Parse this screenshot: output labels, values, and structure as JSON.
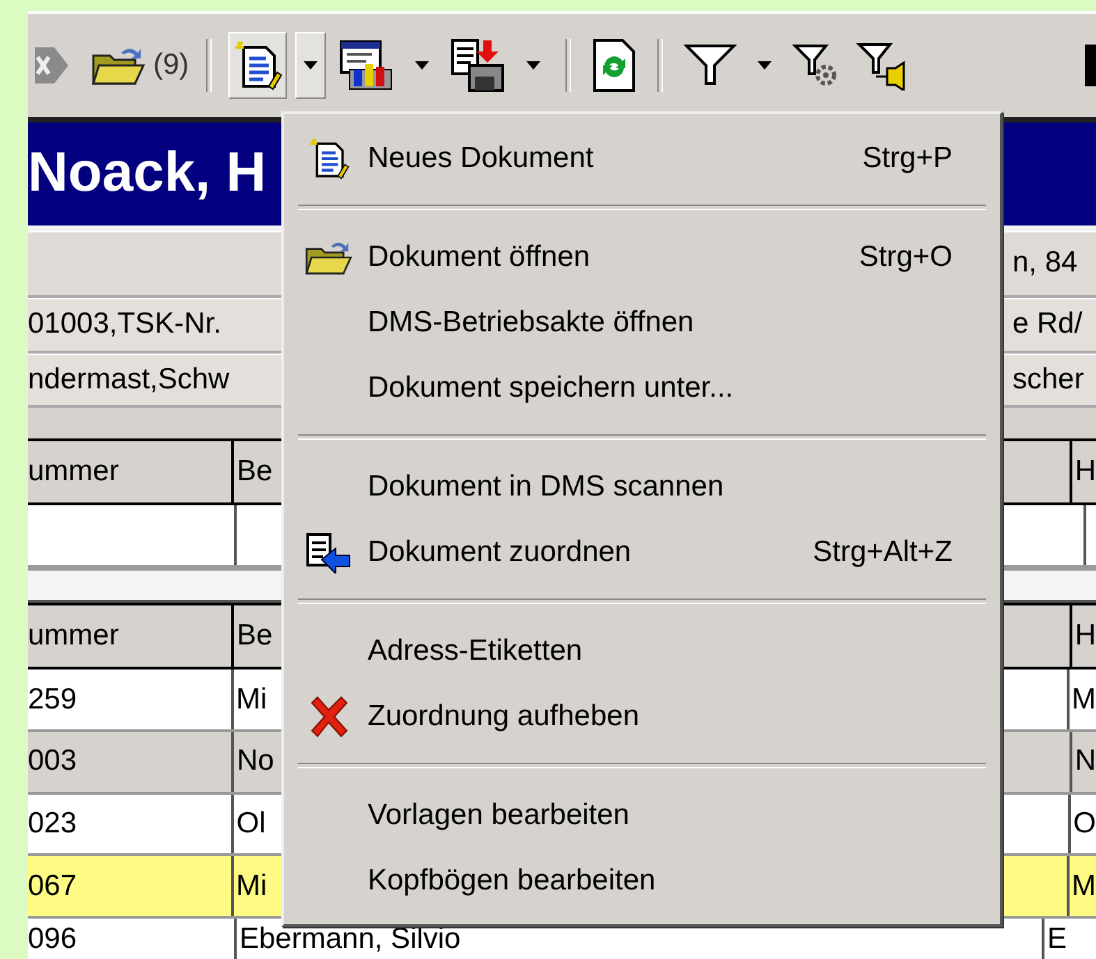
{
  "toolbar": {
    "items": [
      {
        "kind": "icon",
        "pressed": false
      },
      {
        "kind": "icon",
        "pressed": false
      },
      {
        "kind": "text",
        "label": "(9)"
      },
      {
        "kind": "separator"
      },
      {
        "kind": "icon",
        "pressed": true
      },
      {
        "kind": "dropdown",
        "pressed": true
      },
      {
        "kind": "icon",
        "pressed": false
      },
      {
        "kind": "dropdown",
        "pressed": false
      },
      {
        "kind": "icon",
        "pressed": false
      },
      {
        "kind": "dropdown",
        "pressed": false
      },
      {
        "kind": "separator"
      },
      {
        "kind": "icon",
        "pressed": false
      },
      {
        "kind": "separator"
      },
      {
        "kind": "icon",
        "pressed": false
      },
      {
        "kind": "dropdown",
        "pressed": false
      },
      {
        "kind": "icon",
        "pressed": false
      },
      {
        "kind": "icon",
        "pressed": false
      }
    ]
  },
  "title": "Noack, H",
  "info_rows": [
    {
      "left": "",
      "right": "n, 84"
    },
    {
      "left": "01003,TSK-Nr.",
      "right": "e Rd/"
    },
    {
      "left": "ndermast,Schw",
      "right": "scher"
    }
  ],
  "table_1": {
    "columns": [
      "ummer",
      "Be",
      "H"
    ]
  },
  "table_2": {
    "columns": [
      "ummer",
      "Be",
      "H"
    ],
    "rows": [
      {
        "cells": [
          "259",
          "Mi",
          "M"
        ],
        "selected": false,
        "shaded": false
      },
      {
        "cells": [
          "003",
          "No",
          "N"
        ],
        "selected": false,
        "shaded": true
      },
      {
        "cells": [
          "023",
          "Ol",
          "O"
        ],
        "selected": false,
        "shaded": false
      },
      {
        "cells": [
          "067",
          "Mi",
          "M"
        ],
        "selected": true,
        "shaded": false
      },
      {
        "cells": [
          "096",
          "Ebermann, Silvio",
          "E"
        ],
        "selected": false,
        "shaded": false
      }
    ]
  },
  "menu": {
    "sections": [
      [
        {
          "label": "Neues Dokument",
          "shortcut": "Strg+P"
        }
      ],
      [
        {
          "label": "Dokument öffnen",
          "shortcut": "Strg+O"
        },
        {
          "label": "DMS-Betriebsakte öffnen"
        },
        {
          "label": "Dokument speichern unter..."
        }
      ],
      [
        {
          "label": "Dokument in DMS scannen"
        },
        {
          "label": "Dokument zuordnen",
          "shortcut": "Strg+Alt+Z"
        }
      ],
      [
        {
          "label": "Adress-Etiketten"
        },
        {
          "label": "Zuordnung aufheben"
        }
      ],
      [
        {
          "label": "Vorlagen bearbeiten"
        },
        {
          "label": "Kopfbögen bearbeiten"
        }
      ]
    ]
  }
}
